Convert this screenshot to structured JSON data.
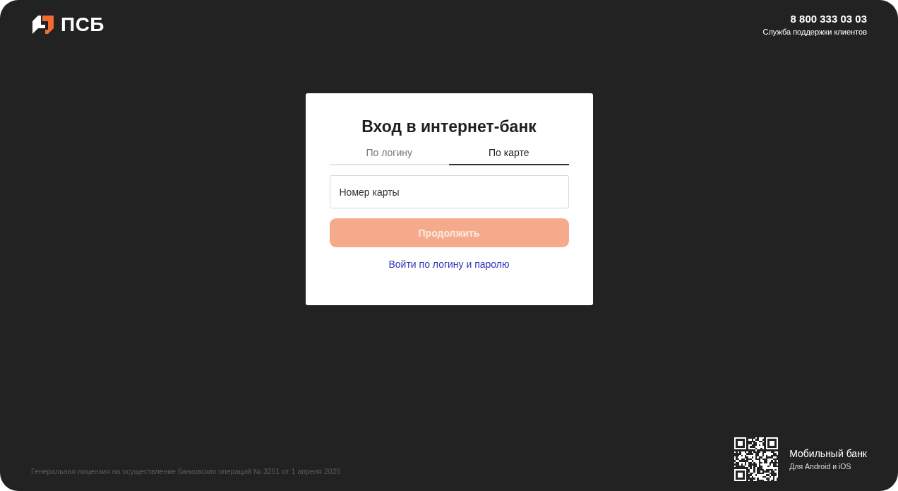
{
  "header": {
    "logo_text": "ПСБ",
    "phone": "8 800 333 03 03",
    "phone_caption": "Служба поддержки клиентов"
  },
  "login": {
    "title": "Вход в интернет-банк",
    "tabs": [
      {
        "label": "По логину",
        "selected": false
      },
      {
        "label": "По карте",
        "selected": true
      }
    ],
    "card_field": {
      "placeholder": "Номер карты"
    },
    "submit": {
      "label": "Продолжить",
      "disabled": true
    },
    "alt_link": "Войти по логину и паролю"
  },
  "footer": {
    "license": "Генеральная лицензия на осуществление банковских операций № 3251 от 1 апреля 2025",
    "app_title": "Мобильный банк",
    "app_caption": "Для Android и iOS"
  }
}
